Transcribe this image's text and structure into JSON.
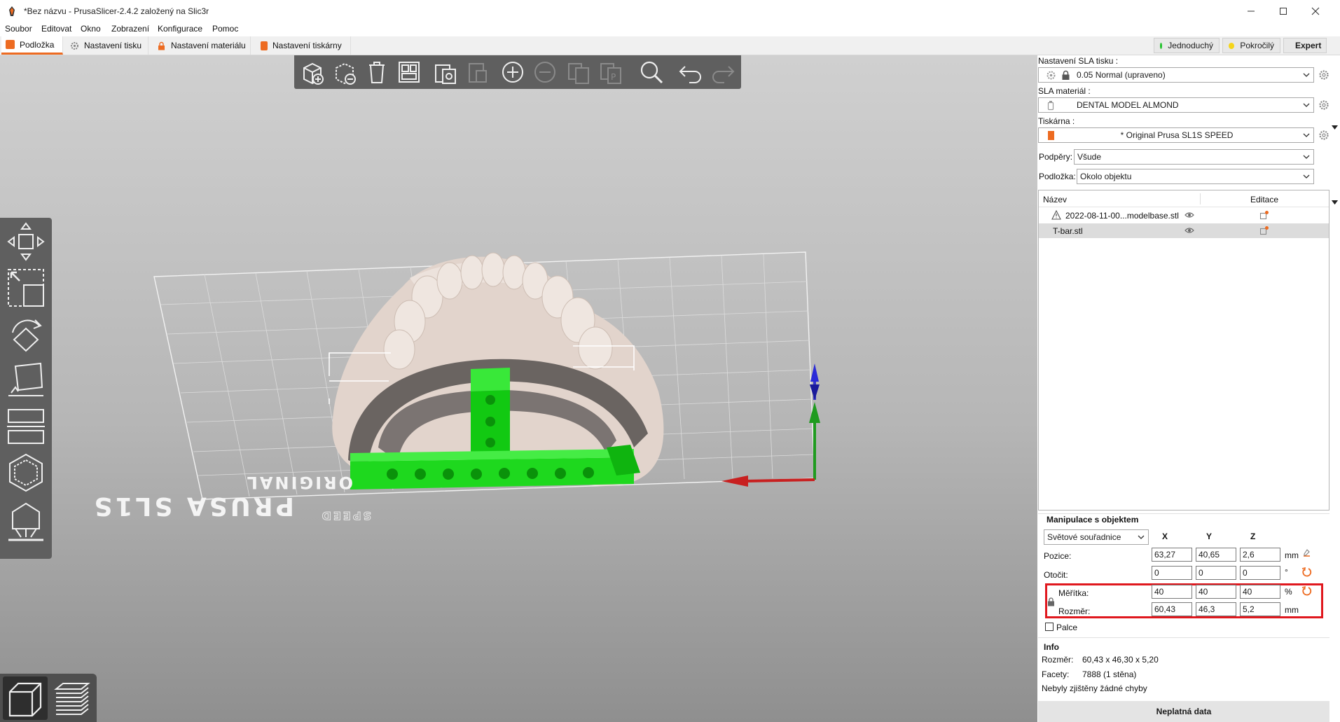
{
  "window": {
    "title": "*Bez názvu - PrusaSlicer-2.4.2 založený na Slic3r"
  },
  "menu": [
    "Soubor",
    "Editovat",
    "Okno",
    "Zobrazení",
    "Konfigurace",
    "Pomoc"
  ],
  "tabs": [
    {
      "label": "Podložka",
      "active": true
    },
    {
      "label": "Nastavení tisku",
      "active": false
    },
    {
      "label": "Nastavení materiálu",
      "active": false
    },
    {
      "label": "Nastavení tiskárny",
      "active": false
    }
  ],
  "modes": [
    {
      "label": "Jednoduchý",
      "color": "#22c22c"
    },
    {
      "label": "Pokročilý",
      "color": "#f5d51a"
    },
    {
      "label": "Expert",
      "color": "#e01010"
    }
  ],
  "scene": {
    "bed_text": [
      "ORIGINAL",
      "PRUSA SL1S",
      "SPEED"
    ]
  },
  "presets": {
    "print_label": "Nastavení SLA tisku :",
    "print_value": "0.05 Normal (upraveno)",
    "material_label": "SLA materiál :",
    "material_value": "DENTAL MODEL ALMOND",
    "printer_label": "Tiskárna :",
    "printer_value": "* Original Prusa SL1S SPEED",
    "supports_label": "Podpěry:",
    "supports_value": "Všude",
    "pad_label": "Podložka:",
    "pad_value": "Okolo objektu"
  },
  "object_list": {
    "col_name": "Název",
    "col_edit": "Editace",
    "items": [
      {
        "name": "2022-08-11-00...modelbase.stl",
        "warning": true,
        "selected": false
      },
      {
        "name": "T-bar.stl",
        "warning": false,
        "selected": true
      }
    ]
  },
  "manipulation": {
    "title": "Manipulace s objektem",
    "coord_system": "Světové souřadnice",
    "axis_x": "X",
    "axis_y": "Y",
    "axis_z": "Z",
    "position_label": "Pozice:",
    "position": [
      "63,27",
      "40,65",
      "2,6"
    ],
    "position_unit": "mm",
    "rotation_label": "Otočit:",
    "rotation": [
      "0",
      "0",
      "0"
    ],
    "rotation_unit": "°",
    "scale_label": "Měřítka:",
    "scale": [
      "40",
      "40",
      "40"
    ],
    "scale_unit": "%",
    "size_label": "Rozměr:",
    "size": [
      "60,43",
      "46,3",
      "5,2"
    ],
    "size_unit": "mm",
    "inches_label": "Palce",
    "highlight_color": "#e0181e"
  },
  "info": {
    "title": "Info",
    "size_label": "Rozměr:",
    "size_value": "60,43 x 46,30 x 5,20",
    "facets_label": "Facety:",
    "facets_value": "7888 (1 stěna)",
    "errors_text": "Nebyly zjištěny žádné chyby"
  },
  "footer": {
    "status_label": "Neplatná data"
  },
  "colors": {
    "accent": "#ed6b21",
    "object_green": "#1ed81e",
    "model_beige": "#e2d4cc"
  }
}
